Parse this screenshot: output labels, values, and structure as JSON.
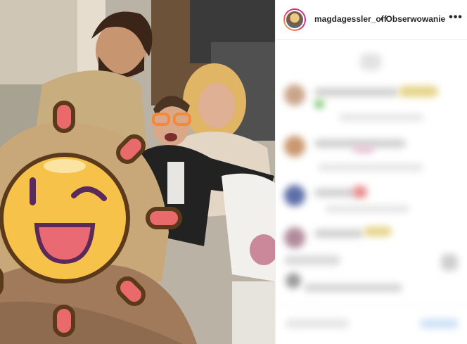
{
  "post": {
    "username": "magdagessler_off",
    "follow_label": "• Obserwowanie",
    "more_icon": "more-horizontal-icon"
  },
  "colors": {
    "text": "#262626",
    "border": "#efefef",
    "emoji_face": "#f6c24a",
    "emoji_outline": "#5a3a1a",
    "emoji_ray": "#e96a6a"
  }
}
